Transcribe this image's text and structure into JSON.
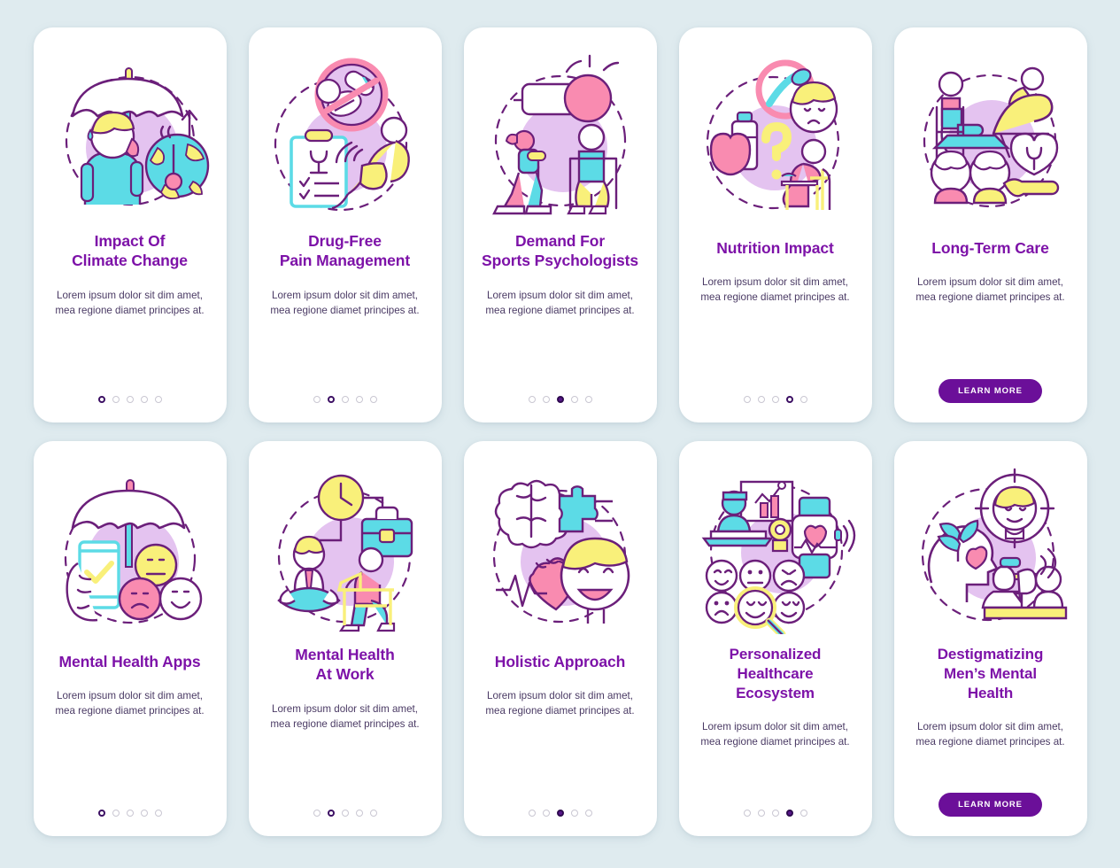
{
  "theme": {
    "background": "#dfebef",
    "card_background": "#ffffff",
    "title_color": "#7d12a8",
    "body_color": "#4a3a64",
    "button_color": "#6b0f99",
    "dot_active_color": "#3c0f63",
    "dot_inactive_color": "#c9c7d2",
    "illustration_accents": [
      "#5cdbe6",
      "#f9f07a",
      "#f98bb0",
      "#e6c4f2",
      "#6b1f7a"
    ]
  },
  "shared": {
    "description": "Lorem ipsum dolor sit dim amet, mea regione diamet principes at.",
    "learn_more_label": "LEARN MORE",
    "dot_count": 5
  },
  "rows": [
    {
      "cards": [
        {
          "title_lines": [
            "Impact Of",
            "Climate Change"
          ],
          "illustration": "umbrella-woman-globe-thermometer-icon",
          "description": "Lorem ipsum dolor sit dim amet, mea regione diamet principes at.",
          "footer": "dots",
          "active_dot": 1,
          "active_filled": false
        },
        {
          "title_lines": [
            "Drug-Free",
            "Pain Management"
          ],
          "illustration": "no-pills-clipboard-back-pain-icon",
          "description": "Lorem ipsum dolor sit dim amet, mea regione diamet principes at.",
          "footer": "dots",
          "active_dot": 2,
          "active_filled": false
        },
        {
          "title_lines": [
            "Demand For",
            "Sports Psychologists"
          ],
          "illustration": "whistle-athlete-coach-icon",
          "description": "Lorem ipsum dolor sit dim amet, mea regione diamet principes at.",
          "footer": "dots",
          "active_dot": 3,
          "active_filled": true
        },
        {
          "title_lines": [
            "Nutrition Impact"
          ],
          "illustration": "apple-milk-question-eating-icon",
          "description": "Lorem ipsum dolor sit dim amet, mea regione diamet principes at.",
          "footer": "dots",
          "active_dot": 4,
          "active_filled": false
        },
        {
          "title_lines": [
            "Long-Term Care"
          ],
          "illustration": "elderly-care-heart-hand-icon",
          "description": "Lorem ipsum dolor sit dim amet, mea regione diamet principes at.",
          "footer": "button",
          "active_dot": 5,
          "active_filled": false
        }
      ]
    },
    {
      "cards": [
        {
          "title_lines": [
            "Mental Health Apps"
          ],
          "illustration": "umbrella-phone-emoji-icon",
          "description": "Lorem ipsum dolor sit dim amet, mea regione diamet principes at.",
          "footer": "dots",
          "active_dot": 1,
          "active_filled": false
        },
        {
          "title_lines": [
            "Mental Health",
            "At Work"
          ],
          "illustration": "clock-briefcase-meditation-desk-icon",
          "description": "Lorem ipsum dolor sit dim amet, mea regione diamet principes at.",
          "footer": "dots",
          "active_dot": 2,
          "active_filled": false
        },
        {
          "title_lines": [
            "Holistic Approach"
          ],
          "illustration": "brain-puzzle-heart-face-icon",
          "description": "Lorem ipsum dolor sit dim amet, mea regione diamet principes at.",
          "footer": "dots",
          "active_dot": 3,
          "active_filled": true
        },
        {
          "title_lines": [
            "Personalized",
            "Healthcare",
            "Ecosystem"
          ],
          "illustration": "telemedicine-smartwatch-emoji-magnifier-icon",
          "description": "Lorem ipsum dolor sit dim amet, mea regione diamet principes at.",
          "footer": "dots",
          "active_dot": 4,
          "active_filled": true
        },
        {
          "title_lines": [
            "Destigmatizing",
            "Men’s Mental",
            "Health"
          ],
          "illustration": "head-plant-heart-target-therapy-icon",
          "description": "Lorem ipsum dolor sit dim amet, mea regione diamet principes at.",
          "footer": "button",
          "active_dot": 5,
          "active_filled": false
        }
      ]
    }
  ]
}
